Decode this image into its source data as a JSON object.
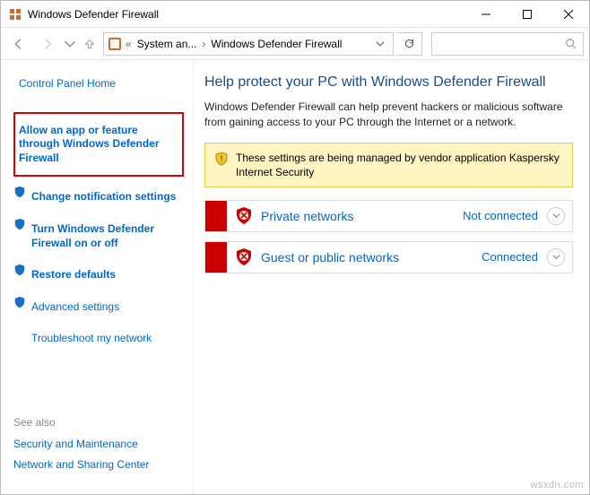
{
  "window": {
    "title": "Windows Defender Firewall"
  },
  "breadcrumb": {
    "item1": "System an...",
    "item2": "Windows Defender Firewall"
  },
  "sidebar": {
    "home": "Control Panel Home",
    "allow_app": "Allow an app or feature through Windows Defender Firewall",
    "change_notif": "Change notification settings",
    "turn_onoff": "Turn Windows Defender Firewall on or off",
    "restore": "Restore defaults",
    "advanced": "Advanced settings",
    "troubleshoot": "Troubleshoot my network",
    "seealso_hdr": "See also",
    "seealso_sec": "Security and Maintenance",
    "seealso_net": "Network and Sharing Center"
  },
  "content": {
    "heading": "Help protect your PC with Windows Defender Firewall",
    "description": "Windows Defender Firewall can help prevent hackers or malicious software from gaining access to your PC through the Internet or a network.",
    "warning": "These settings are being managed by vendor application Kaspersky Internet Security",
    "networks": [
      {
        "name": "Private networks",
        "status": "Not connected"
      },
      {
        "name": "Guest or public networks",
        "status": "Connected"
      }
    ]
  },
  "watermark": "wsxdn.com"
}
